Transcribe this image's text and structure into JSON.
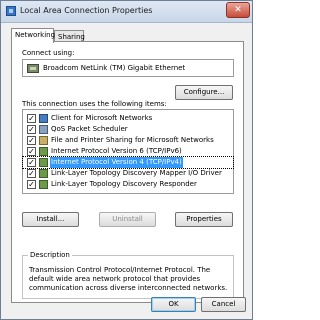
{
  "window": {
    "title": "Local Area Connection Properties",
    "close_glyph": "✕"
  },
  "tabs": [
    {
      "label": "Networking"
    },
    {
      "label": "Sharing"
    }
  ],
  "connect_using": {
    "label": "Connect using:",
    "adapter": "Broadcom NetLink (TM) Gigabit Ethernet",
    "configure_button": "Configure..."
  },
  "items_section": {
    "label": "This connection uses the following items:",
    "items": [
      {
        "label": "Client for Microsoft Networks",
        "checked": true,
        "icon": "client-icon"
      },
      {
        "label": "QoS Packet Scheduler",
        "checked": true,
        "icon": "qos-icon"
      },
      {
        "label": "File and Printer Sharing for Microsoft Networks",
        "checked": true,
        "icon": "file-share-icon"
      },
      {
        "label": "Internet Protocol Version 6 (TCP/IPv6)",
        "checked": true,
        "icon": "protocol-icon"
      },
      {
        "label": "Internet Protocol Version 4 (TCP/IPv4)",
        "checked": true,
        "icon": "protocol-icon",
        "selected": true
      },
      {
        "label": "Link-Layer Topology Discovery Mapper I/O Driver",
        "checked": true,
        "icon": "protocol-icon"
      },
      {
        "label": "Link-Layer Topology Discovery Responder",
        "checked": true,
        "icon": "protocol-icon"
      }
    ]
  },
  "actions": {
    "install": "Install...",
    "uninstall": "Uninstall",
    "properties": "Properties"
  },
  "description": {
    "legend": "Description",
    "text": "Transmission Control Protocol/Internet Protocol. The default wide area network protocol that provides communication across diverse interconnected networks."
  },
  "footer": {
    "ok": "OK",
    "cancel": "Cancel"
  },
  "check_glyph": "✓",
  "colors": {
    "selection": "#3399ff",
    "dialog_bg": "#f0f0f0"
  }
}
